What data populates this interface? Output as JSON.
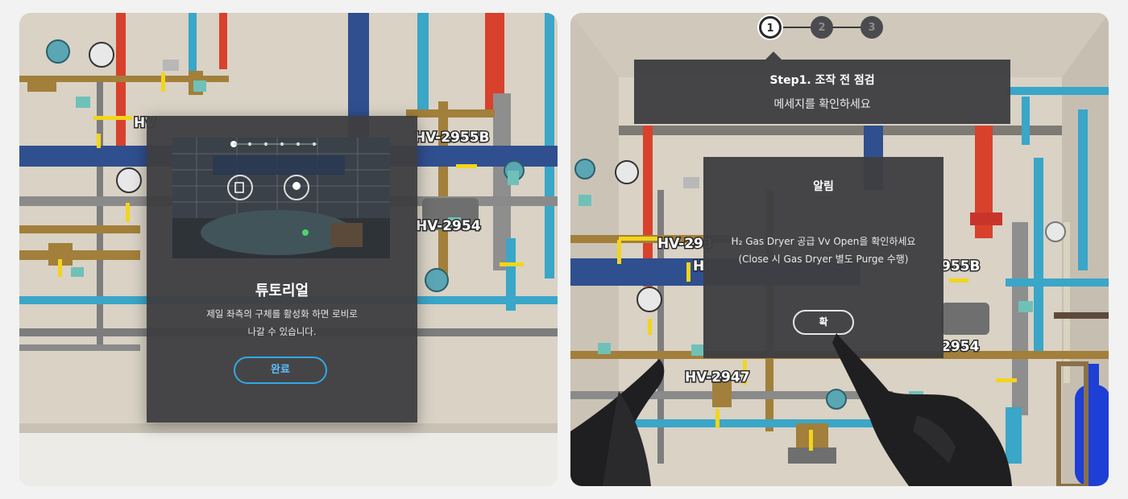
{
  "left": {
    "tutorial": {
      "title": "튜토리얼",
      "description_line1": "제일 좌측의 구체를 활성화 하면 로비로",
      "description_line2": "나갈 수 있습니다.",
      "done_label": "완료",
      "accent_color": "#2fa9e8"
    },
    "valve_labels": [
      "HV-2955B",
      "HV-2954",
      "HV"
    ]
  },
  "right": {
    "steps": {
      "labels": [
        "1",
        "2",
        "3"
      ],
      "current": 1
    },
    "step_title": "Step1. 조작 전 점검",
    "step_message": "메세지를 확인하세요",
    "notice": {
      "title": "알림",
      "line1": "H₂ Gas Dryer 공급 Vv Open을 확인하세요",
      "line2": "(Close 시 Gas Dryer 별도 Purge 수행)",
      "confirm_label": "확"
    },
    "valve_labels": [
      "HV-293",
      "HV-2947",
      "2954",
      "955B",
      "H"
    ]
  },
  "colors": {
    "dialog_bg": "#3e3e42",
    "wall": "#d8d1c4",
    "pipe_blue": "#2f4f8f",
    "pipe_cyan": "#3aa6c8",
    "pipe_red": "#d8412c",
    "pipe_brass": "#a27f3a",
    "marker_yellow": "#f2d51c"
  }
}
